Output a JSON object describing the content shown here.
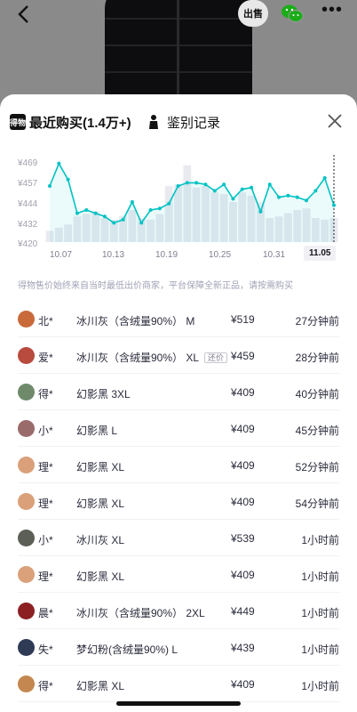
{
  "header": {
    "sell_label": "出售",
    "more_label": "•••"
  },
  "tabs": {
    "recent_logo": "得物",
    "recent_label": "最近购买(1.4万+)",
    "auth_label": "鉴别记录"
  },
  "chart_data": {
    "type": "line",
    "y_ticks": [
      "¥469",
      "¥457",
      "¥444",
      "¥432",
      "¥420"
    ],
    "ylim": [
      420,
      470
    ],
    "x_ticks": [
      "10.07",
      "10.13",
      "10.19",
      "10.25",
      "10.31",
      "11.05"
    ],
    "selected_x": "11.05",
    "series": [
      {
        "values": [
          455,
          469,
          459,
          438,
          440,
          438,
          436,
          432,
          434,
          445,
          432,
          440,
          441,
          444,
          455,
          457,
          457,
          456,
          452,
          456,
          447,
          453,
          454,
          439,
          456,
          448,
          449,
          448,
          446,
          452,
          460,
          443
        ]
      }
    ],
    "volume_bars": [
      0.14,
      0.18,
      0.22,
      0.32,
      0.35,
      0.38,
      0.3,
      0.28,
      0.33,
      0.4,
      0.3,
      0.28,
      0.35,
      0.7,
      0.72,
      0.96,
      0.68,
      0.7,
      0.62,
      0.6,
      0.5,
      0.62,
      0.58,
      0.5,
      0.3,
      0.32,
      0.36,
      0.4,
      0.42,
      0.3,
      0.28,
      0.3
    ]
  },
  "notice": "得物售价始终来自当时最低出价商家，平台保障全新正品，请按需购买",
  "purchases": [
    {
      "buyer": "北*",
      "spec": "冰川灰（含绒量90%） M",
      "tag": "",
      "price": "¥519",
      "time": "27分钟前",
      "avatar_color": "#c96a3b"
    },
    {
      "buyer": "爱*",
      "spec": "冰川灰（含绒量90%） XL",
      "tag": "还价",
      "price": "¥459",
      "time": "28分钟前",
      "avatar_color": "#b84a3e"
    },
    {
      "buyer": "得*",
      "spec": "幻影黑 3XL",
      "tag": "",
      "price": "¥409",
      "time": "40分钟前",
      "avatar_color": "#6e8a6a"
    },
    {
      "buyer": "小*",
      "spec": "幻影黑 L",
      "tag": "",
      "price": "¥409",
      "time": "45分钟前",
      "avatar_color": "#9a6b6b"
    },
    {
      "buyer": "理*",
      "spec": "幻影黑 XL",
      "tag": "",
      "price": "¥409",
      "time": "52分钟前",
      "avatar_color": "#d9a07a"
    },
    {
      "buyer": "理*",
      "spec": "幻影黑 XL",
      "tag": "",
      "price": "¥409",
      "time": "54分钟前",
      "avatar_color": "#d9a07a"
    },
    {
      "buyer": "小*",
      "spec": "冰川灰 XL",
      "tag": "",
      "price": "¥539",
      "time": "1小时前",
      "avatar_color": "#5b5f55"
    },
    {
      "buyer": "理*",
      "spec": "幻影黑 XL",
      "tag": "",
      "price": "¥409",
      "time": "1小时前",
      "avatar_color": "#d9a07a"
    },
    {
      "buyer": "晨*",
      "spec": "冰川灰（含绒量90%） 2XL",
      "tag": "",
      "price": "¥449",
      "time": "1小时前",
      "avatar_color": "#8b1f22"
    },
    {
      "buyer": "失*",
      "spec": "梦幻粉(含绒量90%) L",
      "tag": "",
      "price": "¥439",
      "time": "1小时前",
      "avatar_color": "#2f3a55"
    },
    {
      "buyer": "得*",
      "spec": "幻影黑 XL",
      "tag": "",
      "price": "¥409",
      "time": "1小时前",
      "avatar_color": "#c4874f"
    }
  ],
  "colors": {
    "accent": "#01c2c3",
    "bar_fill": "#e9eaf0"
  }
}
